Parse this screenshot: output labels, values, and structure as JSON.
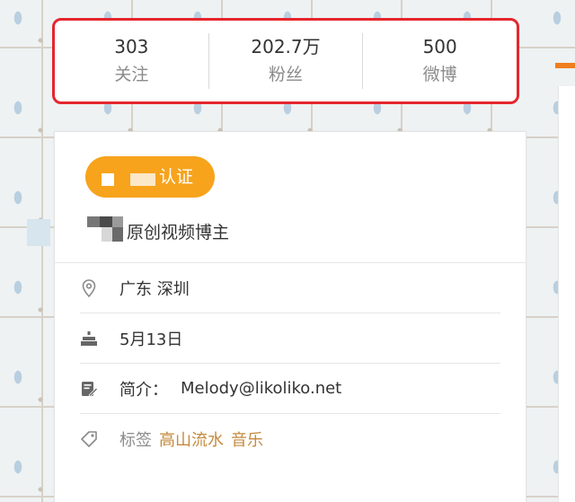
{
  "stats": [
    {
      "value": "303",
      "label": "关注"
    },
    {
      "value": "202.7万",
      "label": "粉丝"
    },
    {
      "value": "500",
      "label": "微博"
    }
  ],
  "certification": {
    "badge_text": "认证",
    "description": "原创视频博主"
  },
  "info": {
    "location": "广东 深圳",
    "birthday": "5月13日",
    "bio_label": "简介：",
    "bio": "Melody@likoliko.net",
    "tags_label": "标签",
    "tags": [
      "高山流水",
      "音乐"
    ]
  },
  "colors": {
    "highlight_border": "#e5262e",
    "badge": "#f7a31c",
    "tag_text": "#c58a3e",
    "accent": "#f07e1f"
  },
  "icons": {
    "location": "map-pin-icon",
    "birthday": "cake-icon",
    "bio": "edit-note-icon",
    "tags": "tag-icon"
  }
}
